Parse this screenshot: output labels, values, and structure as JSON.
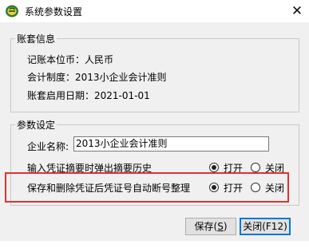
{
  "window": {
    "title": "系统参数设置",
    "close_glyph": "✕"
  },
  "account_info": {
    "legend": "账套信息",
    "currency_label": "记账本位币：",
    "currency_value": "人民币",
    "system_label": "会计制度：",
    "system_value": "2013小企业会计准则",
    "start_date_label": "账套启用日期：",
    "start_date_value": "2021-01-01"
  },
  "params": {
    "legend": "参数设定",
    "company_label": "企业名称:",
    "company_value": "2013小企业会计准则",
    "popup_history": {
      "label": "输入凭证摘要时弹出摘要历史",
      "on_label": "打开",
      "off_label": "关闭",
      "selected": "on"
    },
    "auto_renumber": {
      "label": "保存和删除凭证后凭证号自动断号整理",
      "on_label": "打开",
      "off_label": "关闭",
      "selected": "on"
    }
  },
  "buttons": {
    "save_label": "保存(",
    "save_key": "S",
    "save_tail": ")",
    "close_label": "关闭(F12)"
  },
  "colors": {
    "highlight": "#e03131",
    "focus": "#0078d7"
  }
}
